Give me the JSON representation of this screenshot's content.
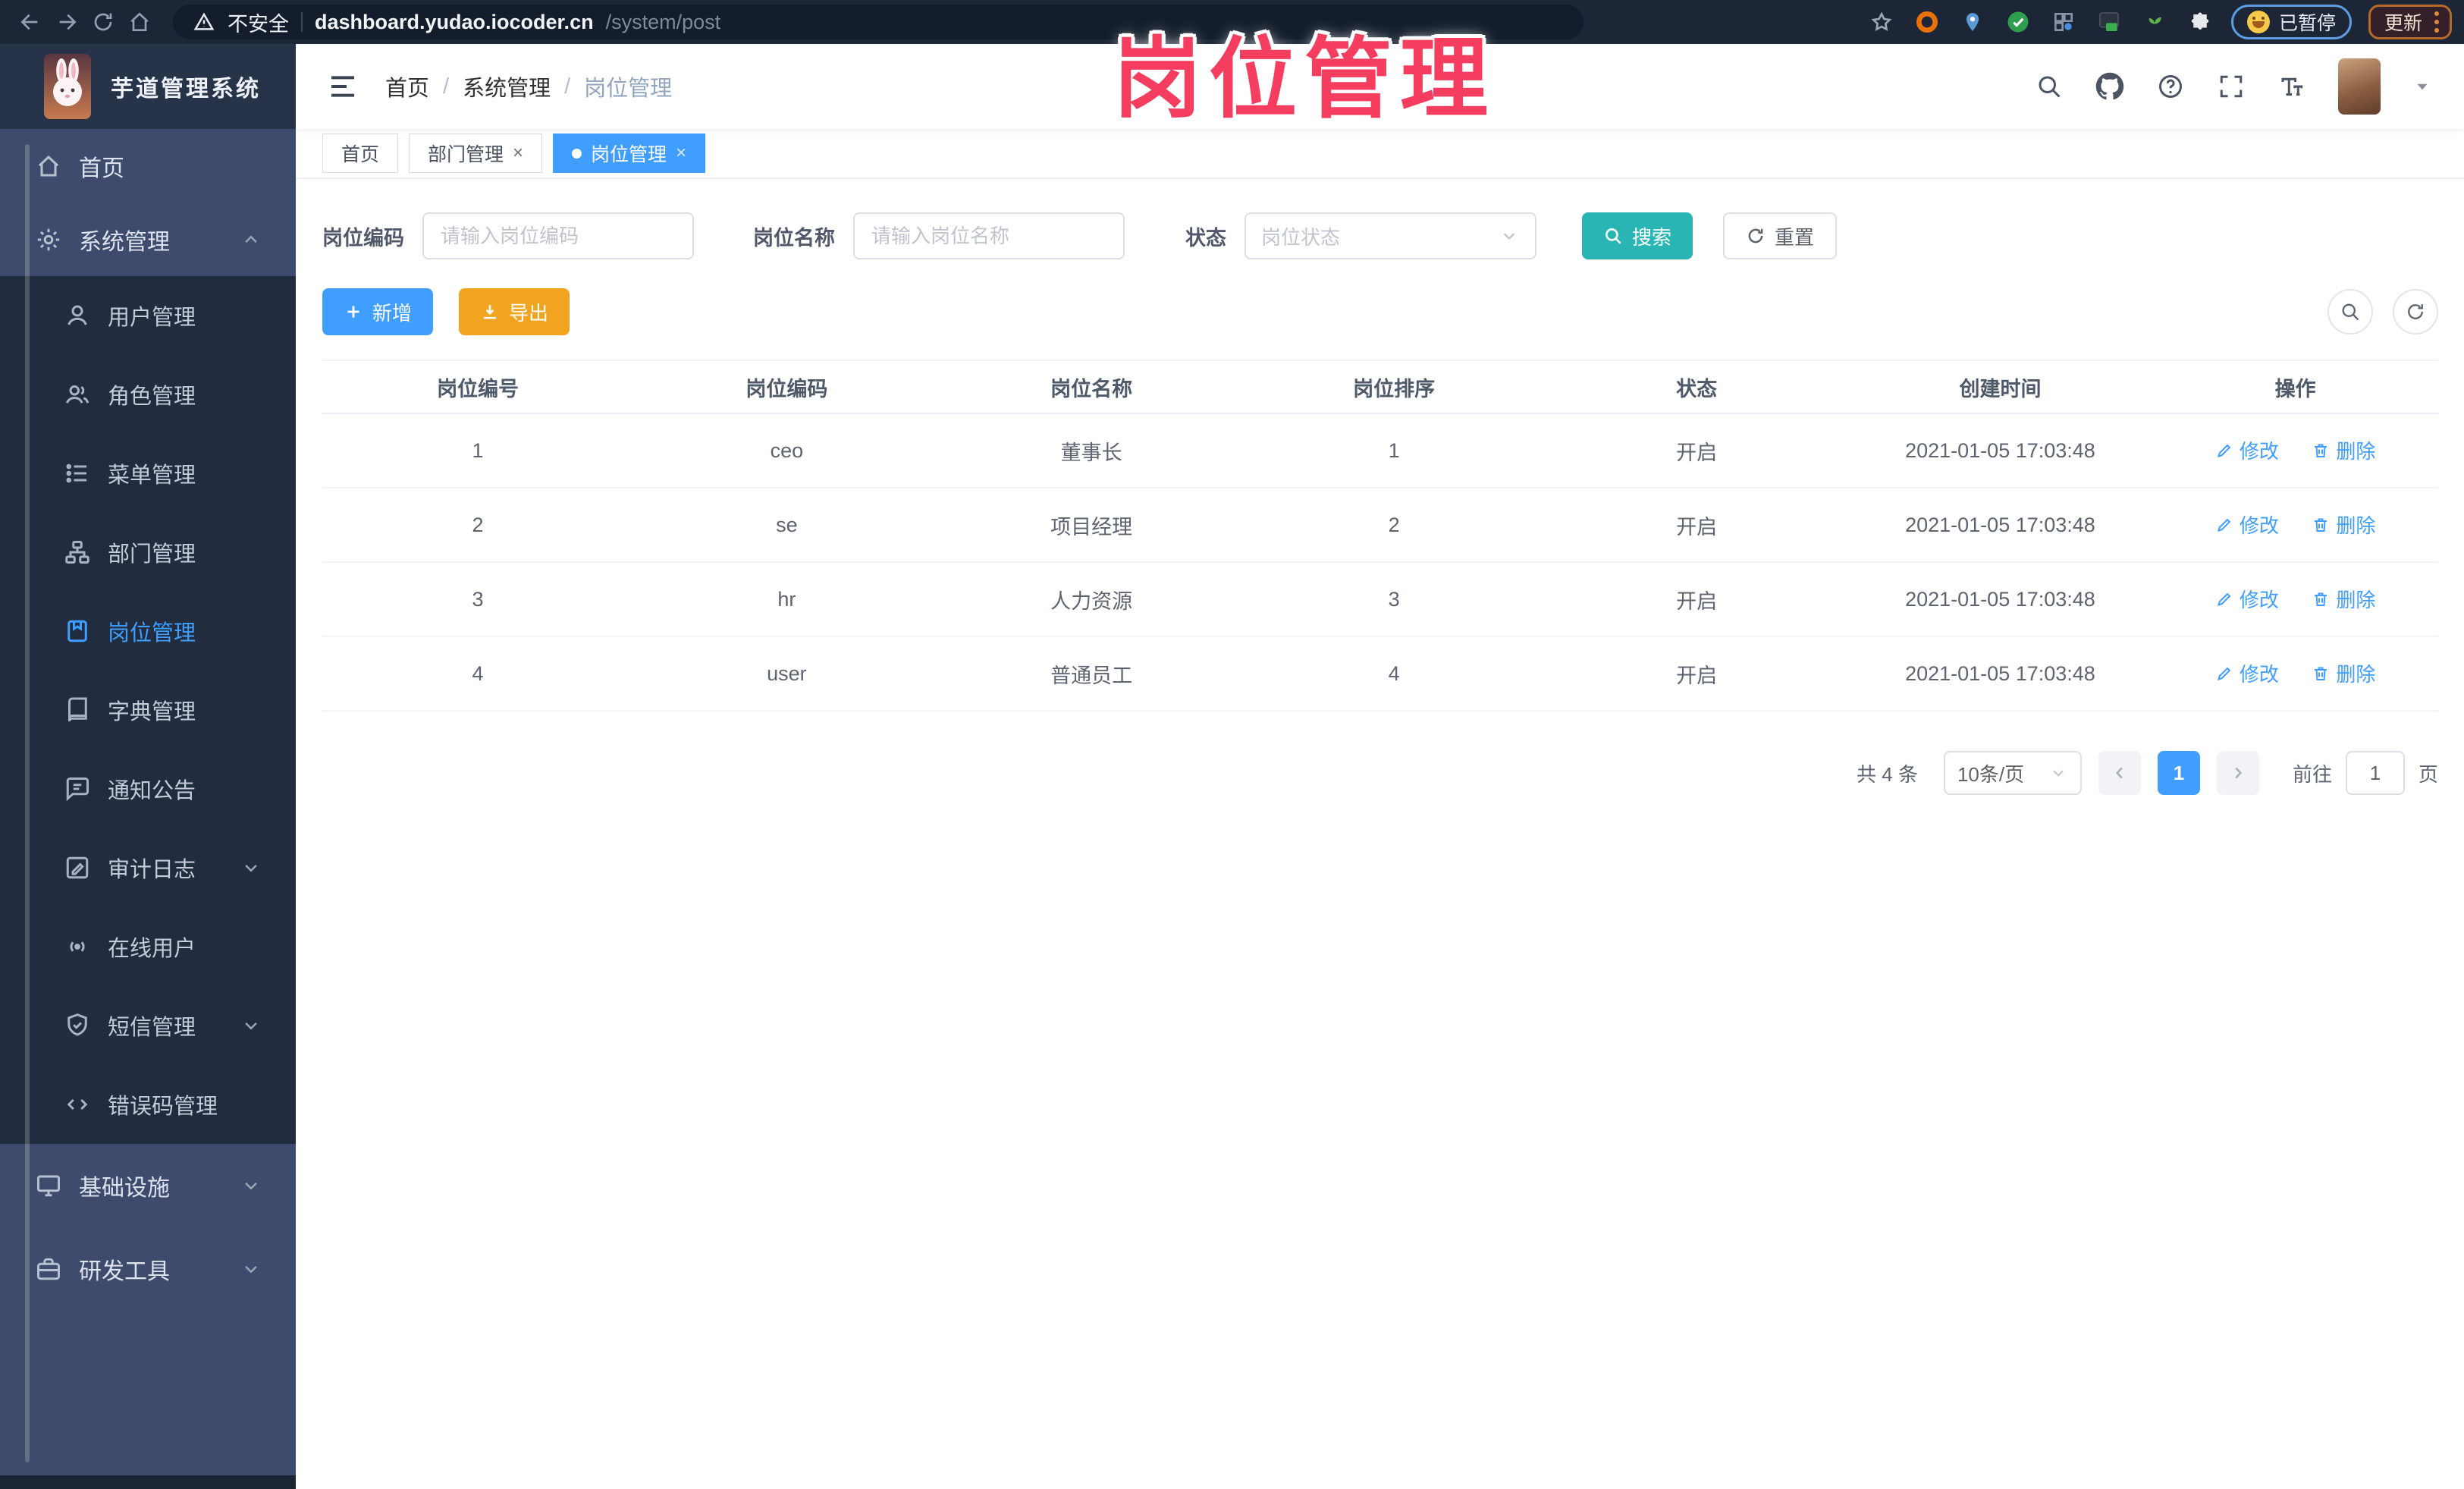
{
  "browser": {
    "security_warning": "不安全",
    "url_host": "dashboard.yudao.iocoder.cn",
    "url_path": "/system/post",
    "paused_badge": "已暂停",
    "update_button": "更新"
  },
  "overlay_title": "岗位管理",
  "sidebar": {
    "app_title": "芋道管理系统",
    "items": [
      {
        "label": "首页"
      },
      {
        "label": "系统管理"
      },
      {
        "label": "用户管理"
      },
      {
        "label": "角色管理"
      },
      {
        "label": "菜单管理"
      },
      {
        "label": "部门管理"
      },
      {
        "label": "岗位管理"
      },
      {
        "label": "字典管理"
      },
      {
        "label": "通知公告"
      },
      {
        "label": "审计日志"
      },
      {
        "label": "在线用户"
      },
      {
        "label": "短信管理"
      },
      {
        "label": "错误码管理"
      },
      {
        "label": "基础设施"
      },
      {
        "label": "研发工具"
      }
    ]
  },
  "header": {
    "breadcrumb": [
      "首页",
      "系统管理",
      "岗位管理"
    ],
    "separator": "/"
  },
  "tabs": [
    {
      "label": "首页"
    },
    {
      "label": "部门管理"
    },
    {
      "label": "岗位管理"
    }
  ],
  "filters": {
    "code_label": "岗位编码",
    "code_placeholder": "请输入岗位编码",
    "name_label": "岗位名称",
    "name_placeholder": "请输入岗位名称",
    "status_label": "状态",
    "status_placeholder": "岗位状态",
    "search_label": "搜索",
    "reset_label": "重置"
  },
  "toolbar": {
    "add_label": "新增",
    "export_label": "导出"
  },
  "table": {
    "columns": [
      "岗位编号",
      "岗位编码",
      "岗位名称",
      "岗位排序",
      "状态",
      "创建时间",
      "操作"
    ],
    "rows": [
      {
        "id": "1",
        "code": "ceo",
        "name": "董事长",
        "sort": "1",
        "status": "开启",
        "created": "2021-01-05 17:03:48"
      },
      {
        "id": "2",
        "code": "se",
        "name": "项目经理",
        "sort": "2",
        "status": "开启",
        "created": "2021-01-05 17:03:48"
      },
      {
        "id": "3",
        "code": "hr",
        "name": "人力资源",
        "sort": "3",
        "status": "开启",
        "created": "2021-01-05 17:03:48"
      },
      {
        "id": "4",
        "code": "user",
        "name": "普通员工",
        "sort": "4",
        "status": "开启",
        "created": "2021-01-05 17:03:48"
      }
    ],
    "edit_label": "修改",
    "delete_label": "删除"
  },
  "pagination": {
    "total_text": "共 4 条",
    "page_size": "10条/页",
    "current_page": "1",
    "goto_label": "前往",
    "goto_value": "1",
    "page_suffix": "页"
  },
  "colors": {
    "accent": "#409eff",
    "search_button": "#2ab5b5",
    "export_button": "#f0a41f",
    "overlay_pink": "#f43d5f",
    "sidebar_dark": "#212d3e",
    "sidebar_light": "#3f4b6d"
  }
}
